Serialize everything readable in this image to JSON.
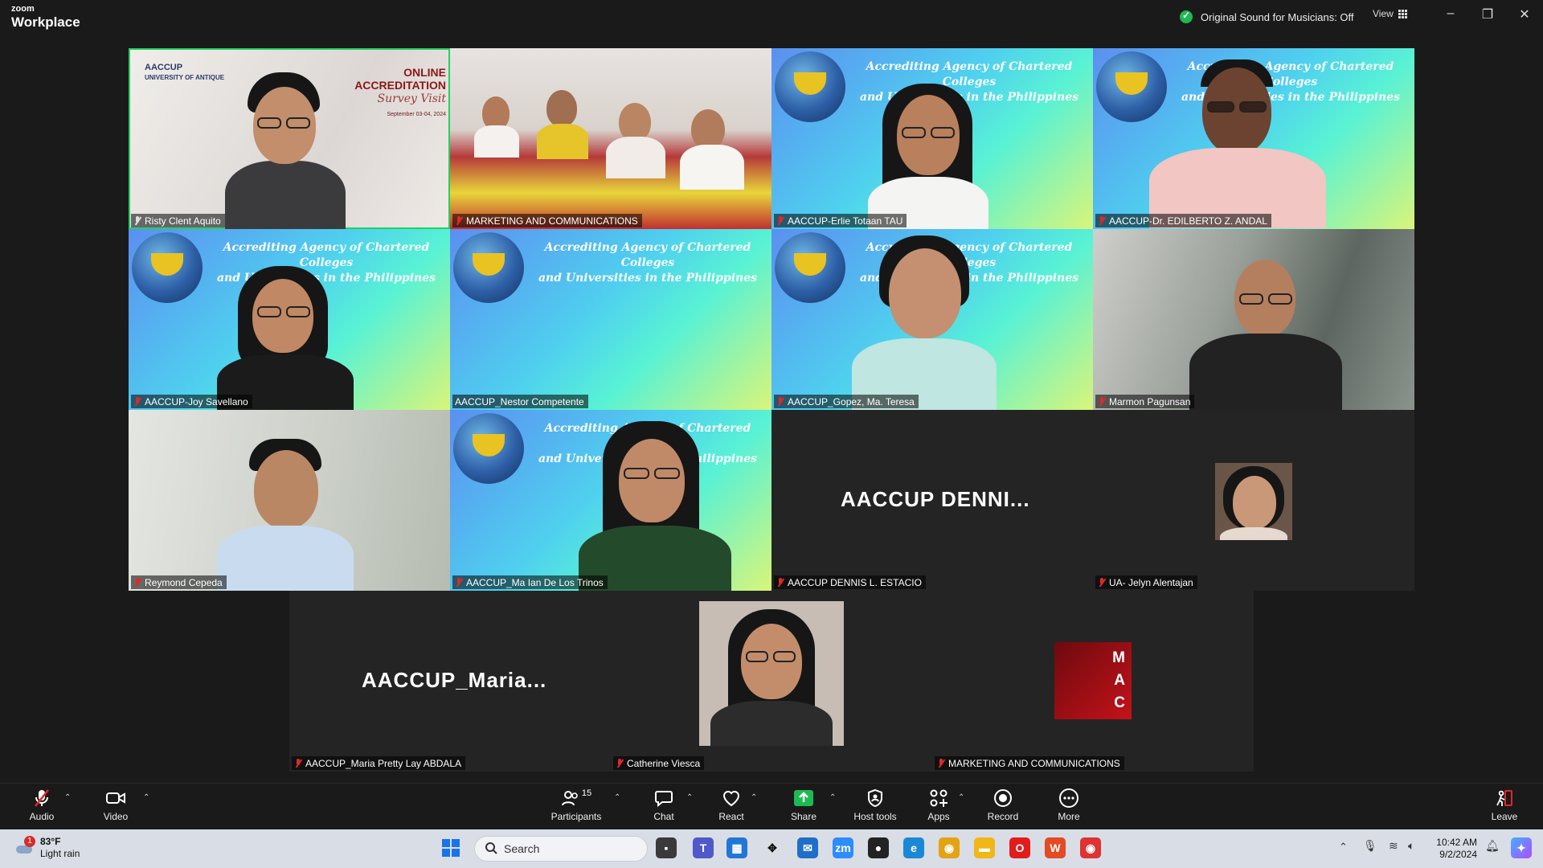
{
  "app": {
    "brand_small": "zoom",
    "brand_large": "Workplace"
  },
  "titlebar": {
    "original_sound": "Original Sound for Musicians: Off",
    "view_label": "View",
    "minimize": "–",
    "restore": "❐",
    "close": "✕"
  },
  "banner": {
    "line1": "Accrediting Agency of Chartered Colleges",
    "line2": "and Universities in the Philippines"
  },
  "virtual_bg_1": {
    "org": "AACCUP",
    "school": "UNIVERSITY OF ANTIQUE",
    "title1": "ONLINE ACCREDITATION",
    "title2": "Survey Visit",
    "dates": "September 03-04, 2024"
  },
  "participants": [
    {
      "name": "Risty Clent Aquito"
    },
    {
      "name": "MARKETING AND COMMUNICATIONS"
    },
    {
      "name": "AACCUP-Erlie Totaan TAU"
    },
    {
      "name": "AACCUP-Dr. EDILBERTO Z. ANDAL"
    },
    {
      "name": "AACCUP-Joy Savellano"
    },
    {
      "name": "AACCUP_Nestor Competente"
    },
    {
      "name": "AACCUP_Gopez, Ma. Teresa"
    },
    {
      "name": "Marmon Pagunsan"
    },
    {
      "name": "Reymond Cepeda"
    },
    {
      "name": "AACCUP_Ma Ian De Los Trinos"
    },
    {
      "name": "AACCUP DENNIS L. ESTACIO",
      "display": "AACCUP  DENNI..."
    },
    {
      "name": "UA- Jelyn Alentajan"
    },
    {
      "name": "AACCUP_Maria Pretty Lay ABDALA",
      "display": "AACCUP_Maria..."
    },
    {
      "name": "Catherine Viesca"
    },
    {
      "name": "MARKETING AND COMMUNICATIONS",
      "avatar_text": [
        "M",
        "A",
        "C"
      ]
    }
  ],
  "toolbar": {
    "audio": "Audio",
    "video": "Video",
    "participants": "Participants",
    "participants_count": "15",
    "chat": "Chat",
    "react": "React",
    "share": "Share",
    "host_tools": "Host tools",
    "apps": "Apps",
    "record": "Record",
    "more": "More",
    "leave": "Leave"
  },
  "taskbar": {
    "weather_temp": "83°F",
    "weather_desc": "Light rain",
    "weather_badge": "1",
    "search_placeholder": "Search",
    "time": "10:42 AM",
    "date": "9/2/2024"
  },
  "colors": {
    "active_speaker": "#23d160",
    "share_green": "#1fb954",
    "muted_red": "#e02828"
  }
}
